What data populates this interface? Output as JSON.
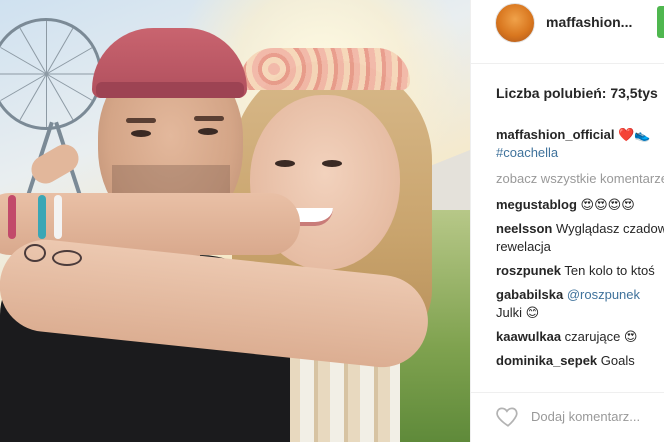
{
  "post": {
    "author": "maffashion...",
    "likes_label": "Liczba polubień: 73,5tys",
    "caption_user": "maffashion_official",
    "caption_emoji": "❤️👟",
    "caption_hashtag": "#coachella",
    "see_all": "zobacz wszystkie komentarze",
    "comments": [
      {
        "user": "megustablog",
        "text": "😍😍😍😍"
      },
      {
        "user": "neelsson",
        "text": "Wyglądasz czadowo!",
        "text2": "rewelacja"
      },
      {
        "user": "roszpunek",
        "text": "Ten kolo to ktoś"
      },
      {
        "user": "gababilska",
        "mention": "@roszpunek",
        "text": "",
        "text2": "Julki 😊"
      },
      {
        "user": "kaawulkaa",
        "text": "czarujące 😍"
      },
      {
        "user": "dominika_sepek",
        "text": "Goals"
      }
    ],
    "add_comment_placeholder": "Dodaj komentarz..."
  },
  "icons": {
    "like": "heart-outline-icon",
    "author_avatar": "avatar-image"
  },
  "colors": {
    "link": "#3f729b",
    "follow": "#4fb74f",
    "muted": "#999999"
  }
}
